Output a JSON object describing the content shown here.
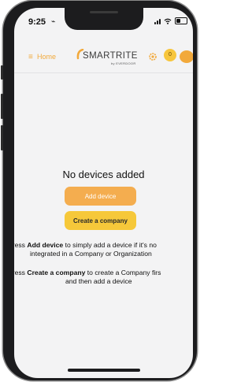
{
  "status_bar": {
    "time": "9:25",
    "bell_glyph": "⌁"
  },
  "header": {
    "menu_glyph": "≡",
    "home_label": "Home",
    "logo_text": "SMARTRITE",
    "logo_subtext": "by EVERDOOR",
    "notification_count": "0",
    "accent_color": "#f2a93b"
  },
  "main": {
    "empty_title": "No devices added",
    "add_device_label": "Add device",
    "create_company_label": "Create a company",
    "hint1": {
      "prefix": "Press ",
      "bold": "Add device",
      "suffix": " to simply add a device if it's no",
      "line2": "integrated in a Company or Organization"
    },
    "hint2": {
      "prefix": "Press ",
      "bold": "Create a company",
      "suffix": " to create a Company firs",
      "line2": "and then add a device"
    }
  }
}
